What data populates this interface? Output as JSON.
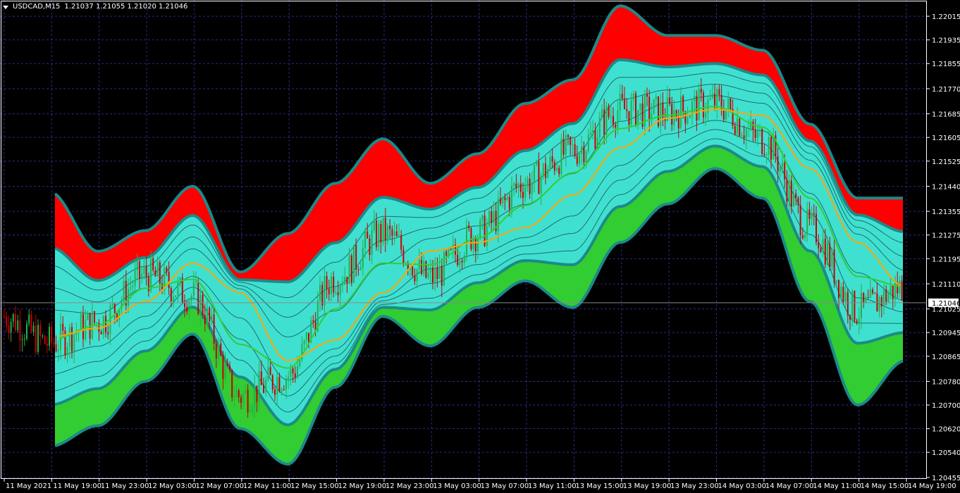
{
  "header": {
    "symbol": "USDCAD,M15",
    "ohlc": "1.21037 1.21055 1.21020 1.21046"
  },
  "price_scale": {
    "ticks": [
      "1.22015",
      "1.21935",
      "1.21855",
      "1.21770",
      "1.21685",
      "1.21605",
      "1.21525",
      "1.21440",
      "1.21355",
      "1.21275",
      "1.21195",
      "1.21110",
      "1.21025",
      "1.20945",
      "1.20865",
      "1.20780",
      "1.20700",
      "1.20620",
      "1.20540",
      "1.20455"
    ],
    "current_price": "1.21046"
  },
  "time_axis": {
    "labels": [
      "11 May 2021",
      "11 May 19:00",
      "11 May 23:00",
      "12 May 03:00",
      "12 May 07:00",
      "12 May 11:00",
      "12 May 15:00",
      "12 May 19:00",
      "12 May 23:00",
      "13 May 03:00",
      "13 May 07:00",
      "13 May 11:00",
      "13 May 15:00",
      "13 May 19:00",
      "13 May 23:00",
      "14 May 03:00",
      "14 May 07:00",
      "14 May 11:00",
      "14 May 15:00",
      "14 May 19:00"
    ]
  },
  "colors": {
    "background": "#000000",
    "grid": "#2a2a8a",
    "bull": "#22b14c",
    "bear": "#c80000",
    "upper_band": "#ff0000",
    "lower_band": "#32cd32",
    "channel": "#40e0d0",
    "band_edge": "#1b8a8a",
    "ma_fast": "#32cd32",
    "ma_slow": "#ffa500",
    "text": "#ffffff"
  },
  "chart_data": {
    "type": "line",
    "xlabel": "",
    "ylabel": "",
    "ylim": [
      1.2045,
      1.2207
    ],
    "x": [
      "11 May 2021",
      "11 May 19:00",
      "11 May 23:00",
      "12 May 03:00",
      "12 May 07:00",
      "12 May 11:00",
      "12 May 15:00",
      "12 May 19:00",
      "12 May 23:00",
      "13 May 03:00",
      "13 May 07:00",
      "13 May 11:00",
      "13 May 15:00",
      "13 May 19:00",
      "13 May 23:00",
      "14 May 03:00",
      "14 May 07:00",
      "14 May 11:00",
      "14 May 15:00",
      "14 May 19:00"
    ],
    "series": [
      {
        "values": [
          null,
          1.2091,
          1.2098,
          1.2114,
          1.2107,
          1.2073,
          1.208,
          1.2113,
          1.2128,
          1.2113,
          1.2128,
          1.2145,
          1.2156,
          1.217,
          1.2169,
          1.2172,
          1.216,
          1.213,
          1.2102,
          1.211
        ]
      },
      {
        "values": [
          1.21,
          1.2093,
          1.2096,
          1.2105,
          1.2118,
          1.2108,
          1.2085,
          1.2092,
          1.2108,
          1.2122,
          1.2125,
          1.213,
          1.2141,
          1.2157,
          1.2167,
          1.217,
          1.2168,
          1.215,
          1.2125,
          1.211
        ]
      },
      {
        "values": [
          null,
          1.2142,
          1.2122,
          1.2129,
          1.2144,
          1.2115,
          1.2128,
          1.2145,
          1.216,
          1.2145,
          1.2155,
          1.2172,
          1.218,
          1.2205,
          1.2195,
          1.2195,
          1.219,
          1.2165,
          1.214,
          1.214
        ]
      },
      {
        "values": [
          null,
          1.2056,
          1.2063,
          1.2078,
          1.2094,
          1.2062,
          1.205,
          1.2076,
          1.21,
          1.209,
          1.2103,
          1.2112,
          1.2103,
          1.2125,
          1.2138,
          1.215,
          1.214,
          1.2105,
          1.207,
          1.2085
        ]
      }
    ]
  }
}
